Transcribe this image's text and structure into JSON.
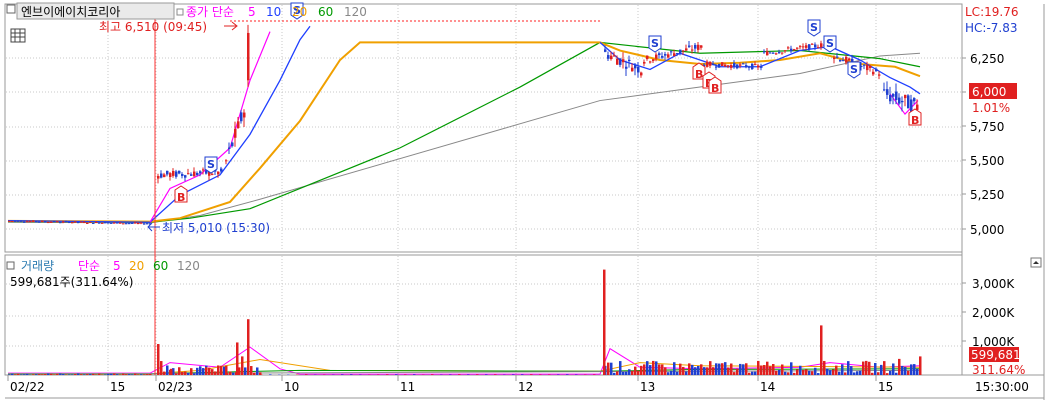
{
  "stock_name": "엔브이에이치코리아",
  "price_legend": {
    "label": "종가 단순",
    "periods": [
      {
        "label": "5",
        "color": "#ff00ff"
      },
      {
        "label": "10",
        "color": "#1f3fff"
      },
      {
        "label": "20",
        "color": "#f0a000"
      },
      {
        "label": "60",
        "color": "#009900"
      },
      {
        "label": "120",
        "color": "#888888"
      }
    ]
  },
  "lc_label": "LC:19.76",
  "hc_label": "HC:-7.83",
  "high_annotation": "최고 6,510 (09:45)",
  "low_annotation": "최저 5,010 (15:30)",
  "price_current": "6,000",
  "price_change": "1.01%",
  "price_axis": [
    "6,250",
    "6,000",
    "5,750",
    "5,500",
    "5,250",
    "5,000"
  ],
  "volume_legend": {
    "label": "거래량",
    "ma_label": "단순",
    "periods": [
      {
        "label": "5",
        "color": "#ff00ff"
      },
      {
        "label": "20",
        "color": "#f0a000"
      },
      {
        "label": "60",
        "color": "#009900"
      },
      {
        "label": "120",
        "color": "#888888"
      }
    ]
  },
  "volume_info": "599,681주(311.64%)",
  "volume_axis": [
    "3,000K",
    "2,000K",
    "1,000K"
  ],
  "volume_current": "599,681",
  "volume_change": "311.64%",
  "time_axis": [
    {
      "label": "02/22"
    },
    {
      "label": "15"
    },
    {
      "label": "02/23"
    },
    {
      "label": "10"
    },
    {
      "label": "11"
    },
    {
      "label": "12"
    },
    {
      "label": "13"
    },
    {
      "label": "14"
    },
    {
      "label": "15"
    }
  ],
  "time_corner": "15:30:00",
  "marker_sell": "S",
  "marker_buy": "B",
  "colors": {
    "up": "#e02020",
    "down": "#1f3fd0",
    "ma5": "#ff00ff",
    "ma10": "#1f3fff",
    "ma20": "#f0a000",
    "ma60": "#009900",
    "ma120": "#888888"
  },
  "chart_data": {
    "type": "candlestick",
    "price_unit": "KRW",
    "ylim_price": [
      4900,
      6500
    ],
    "high": 6510,
    "low": 5010,
    "last_price": 6000,
    "last_volume": 599681,
    "ylim_volume_k": [
      0,
      3800
    ]
  }
}
